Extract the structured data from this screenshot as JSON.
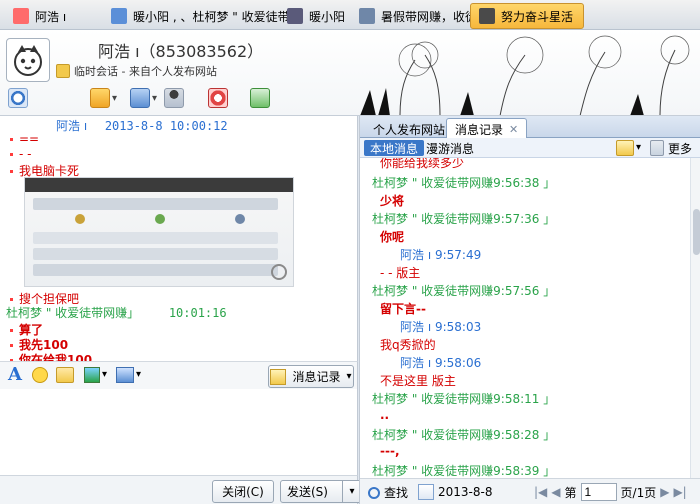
{
  "tabs": [
    {
      "label": "阿浩 ı",
      "active": false,
      "avatar_color": "#ff6b6b"
    },
    {
      "label": "暖小阳 , 、杜柯梦 \" 收爱徒带",
      "active": false,
      "avatar_color": "#5b8fd8"
    },
    {
      "label": "暖小阳",
      "active": false,
      "avatar_color": "#5a5a7a"
    },
    {
      "label": "暑假带网赚，收徒",
      "active": false,
      "avatar_color": "#6f87a8"
    },
    {
      "label": "努力奋斗星活",
      "active": true,
      "avatar_color": "#f0b03a"
    }
  ],
  "header": {
    "name_line": "阿浩 ı（853083562）",
    "sub_line": "临时会话 - 来自个人发布网站"
  },
  "chat": {
    "sender1": "阿浩 ı",
    "time1": "2013-8-8 10:00:12",
    "lines1": [
      "==",
      "- -",
      "我电脑卡死"
    ],
    "line_after_img": "搜个担保吧",
    "sender2": "杜柯梦 \" 收爱徒带网赚」",
    "time2": "10:01:16",
    "bold_lines": [
      "算了",
      "我先100",
      "你在给我100"
    ]
  },
  "input_toolbar": {
    "history_button": "消息记录"
  },
  "bottom_buttons": {
    "close": "关闭(C)",
    "send": "发送(S)"
  },
  "right_panel": {
    "tabs": [
      "个人发布网站",
      "消息记录"
    ],
    "subtabs": [
      "本地消息",
      "漫游消息"
    ],
    "more_label": "更多",
    "history": [
      {
        "type": "msg",
        "text": "你能给我续多少",
        "color": "#d40000",
        "bold": false
      },
      {
        "type": "hdr",
        "text": "杜柯梦 \" 收爱徒带网赚9:56:38 」",
        "color": "#2aa34a"
      },
      {
        "type": "msg",
        "text": "少将",
        "color": "#d40000",
        "bold": true
      },
      {
        "type": "hdr",
        "text": "杜柯梦 \" 收爱徒带网赚9:57:36 」",
        "color": "#2aa34a"
      },
      {
        "type": "msg",
        "text": "你呢",
        "color": "#d40000",
        "bold": true
      },
      {
        "type": "hdr",
        "text": "阿浩 ı 9:57:49",
        "color": "#2a6fd1"
      },
      {
        "type": "msg",
        "text": "- - 版主",
        "color": "#d40000",
        "bold": false
      },
      {
        "type": "hdr",
        "text": "杜柯梦 \" 收爱徒带网赚9:57:56 」",
        "color": "#2aa34a"
      },
      {
        "type": "msg",
        "text": "留下言--",
        "color": "#d40000",
        "bold": true
      },
      {
        "type": "hdr",
        "text": "阿浩 ı 9:58:03",
        "color": "#2a6fd1"
      },
      {
        "type": "msg",
        "text": "我q秀掀的",
        "color": "#d40000",
        "bold": false
      },
      {
        "type": "hdr",
        "text": "阿浩 ı 9:58:06",
        "color": "#2a6fd1"
      },
      {
        "type": "msg",
        "text": "不是这里 版主",
        "color": "#d40000",
        "bold": false
      },
      {
        "type": "hdr",
        "text": "杜柯梦 \" 收爱徒带网赚9:58:11 」",
        "color": "#2aa34a"
      },
      {
        "type": "msg",
        "text": "..",
        "color": "#d40000",
        "bold": true
      },
      {
        "type": "hdr",
        "text": "杜柯梦 \" 收爱徒带网赚9:58:28 」",
        "color": "#2aa34a"
      },
      {
        "type": "msg",
        "text": "---,",
        "color": "#d40000",
        "bold": true
      },
      {
        "type": "hdr",
        "text": "杜柯梦 \" 收爱徒带网赚9:58:39 」",
        "color": "#2aa34a"
      }
    ],
    "bottom": {
      "search_label": "查找",
      "date": "2013-8-8",
      "page_prefix": "第",
      "page_value": "1",
      "page_suffix": "页/1页"
    }
  },
  "colors": {
    "accent_tab": "#f6b73c",
    "sender_blue": "#2a6fd1",
    "sender_green": "#2aa34a",
    "message_red": "#d40000"
  }
}
